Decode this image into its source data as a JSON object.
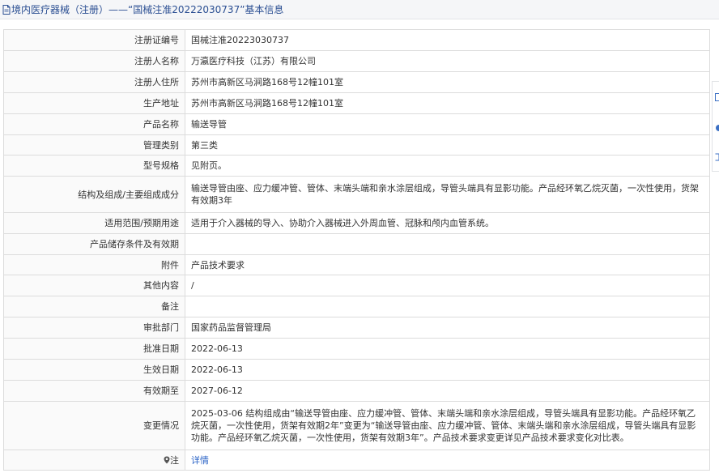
{
  "header": {
    "title": "境内医疗器械（注册）——“国械注准20222030737”基本信息",
    "icon": "document-icon"
  },
  "rows": [
    {
      "label": "注册证编号",
      "value": "国械注准20223030737"
    },
    {
      "label": "注册人名称",
      "value": "万瀛医疗科技（江苏）有限公司"
    },
    {
      "label": "注册人住所",
      "value": "苏州市高新区马涧路168号12幢101室"
    },
    {
      "label": "生产地址",
      "value": "苏州市高新区马涧路168号12幢101室"
    },
    {
      "label": "产品名称",
      "value": "输送导管"
    },
    {
      "label": "管理类别",
      "value": "第三类"
    },
    {
      "label": "型号规格",
      "value": "见附页。"
    },
    {
      "label": "结构及组成/主要组成成分",
      "value": "输送导管由座、应力缓冲管、管体、末端头端和亲水涂层组成，导管头端具有显影功能。产品经环氧乙烷灭菌，一次性使用，货架有效期3年"
    },
    {
      "label": "适用范围/预期用途",
      "value": "适用于介入器械的导入、协助介入器械进入外周血管、冠脉和颅内血管系统。"
    },
    {
      "label": "产品储存条件及有效期",
      "value": ""
    },
    {
      "label": "附件",
      "value": "产品技术要求"
    },
    {
      "label": "其他内容",
      "value": "/"
    },
    {
      "label": "备注",
      "value": ""
    },
    {
      "label": "审批部门",
      "value": "国家药品监督管理局"
    },
    {
      "label": "批准日期",
      "value": "2022-06-13"
    },
    {
      "label": "生效日期",
      "value": "2022-06-13"
    },
    {
      "label": "有效期至",
      "value": "2027-06-12"
    },
    {
      "label": "变更情况",
      "value": "2025-03-06 结构组成由“输送导管由座、应力缓冲管、管体、末端头端和亲水涂层组成，导管头端具有显影功能。产品经环氧乙烷灭菌，一次性使用，货架有效期2年”变更为“输送导管由座、应力缓冲管、管体、末端头端和亲水涂层组成，导管头端具有显影功能。产品经环氧乙烷灭菌，一次性使用，货架有效期3年”。产品技术要求变更详见产品技术要求变化对比表。"
    }
  ],
  "note_row": {
    "label": "注",
    "link_text": "详情",
    "icon": "location-pin-icon"
  },
  "colors": {
    "title": "#2a4e92",
    "link": "#2a63c6",
    "border": "#dcdcdc",
    "label_bg": "#fafafa"
  }
}
